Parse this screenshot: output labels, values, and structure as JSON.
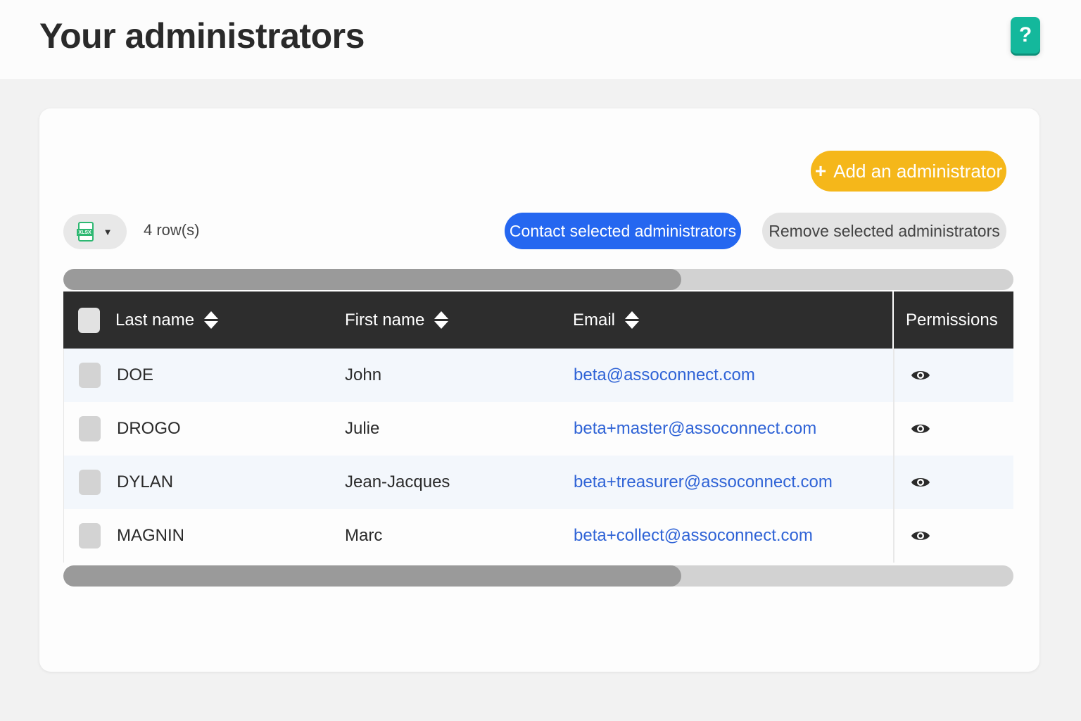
{
  "header": {
    "title": "Your administrators",
    "help_label": "?"
  },
  "toolbar": {
    "add_label": "Add an administrator",
    "add_icon": "plus-icon",
    "export_icon": "xlsx-file-icon",
    "export_badge": "XLSX",
    "row_count": "4 row(s)",
    "contact_label": "Contact selected administrators",
    "remove_label": "Remove selected administrators"
  },
  "table": {
    "columns": {
      "last_name": "Last name",
      "first_name": "First name",
      "email": "Email",
      "permissions": "Permissions"
    },
    "rows": [
      {
        "last_name": "DOE",
        "first_name": "John",
        "email": "beta@assoconnect.com"
      },
      {
        "last_name": "DROGO",
        "first_name": "Julie",
        "email": "beta+master@assoconnect.com"
      },
      {
        "last_name": "DYLAN",
        "first_name": "Jean-Jacques",
        "email": "beta+treasurer@assoconnect.com"
      },
      {
        "last_name": "MAGNIN",
        "first_name": "Marc",
        "email": "beta+collect@assoconnect.com"
      }
    ]
  },
  "colors": {
    "accent_yellow": "#f5b71a",
    "accent_blue": "#2567f0",
    "help_green": "#14b89c",
    "header_dark": "#2d2d2d",
    "link_blue": "#2f63d6"
  }
}
